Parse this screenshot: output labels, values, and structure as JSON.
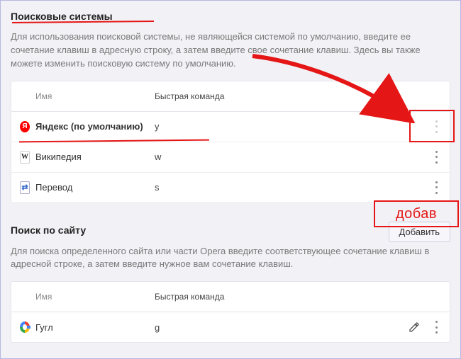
{
  "section1": {
    "title": "Поисковые системы",
    "desc": "Для использования поисковой системы, не являющейся системой по умолчанию, введите ее сочетание клавиш в адресную строку, а затем введите свое сочетание клавиш. Здесь вы также можете изменить поисковую систему по умолчанию.",
    "col_name": "Имя",
    "col_cmd": "Быстрая команда",
    "rows": {
      "0": {
        "icon": "Я",
        "name": "Яндекс (по умолчанию)",
        "cmd": "y"
      },
      "1": {
        "icon": "W",
        "name": "Википедия",
        "cmd": "w"
      },
      "2": {
        "icon": "⇄",
        "name": "Перевод",
        "cmd": "s"
      }
    }
  },
  "section2": {
    "title": "Поиск по сайту",
    "add_btn": "Добавить",
    "desc": "Для поиска определенного сайта или части Opera введите соответствующее сочетание клавиш в адресной строке, а затем введите нужное вам сочетание клавиш.",
    "col_name": "Имя",
    "col_cmd": "Быстрая команда",
    "rows": {
      "0": {
        "name": "Гугл",
        "cmd": "g"
      }
    }
  },
  "annotation": {
    "box2_label": "добав"
  }
}
